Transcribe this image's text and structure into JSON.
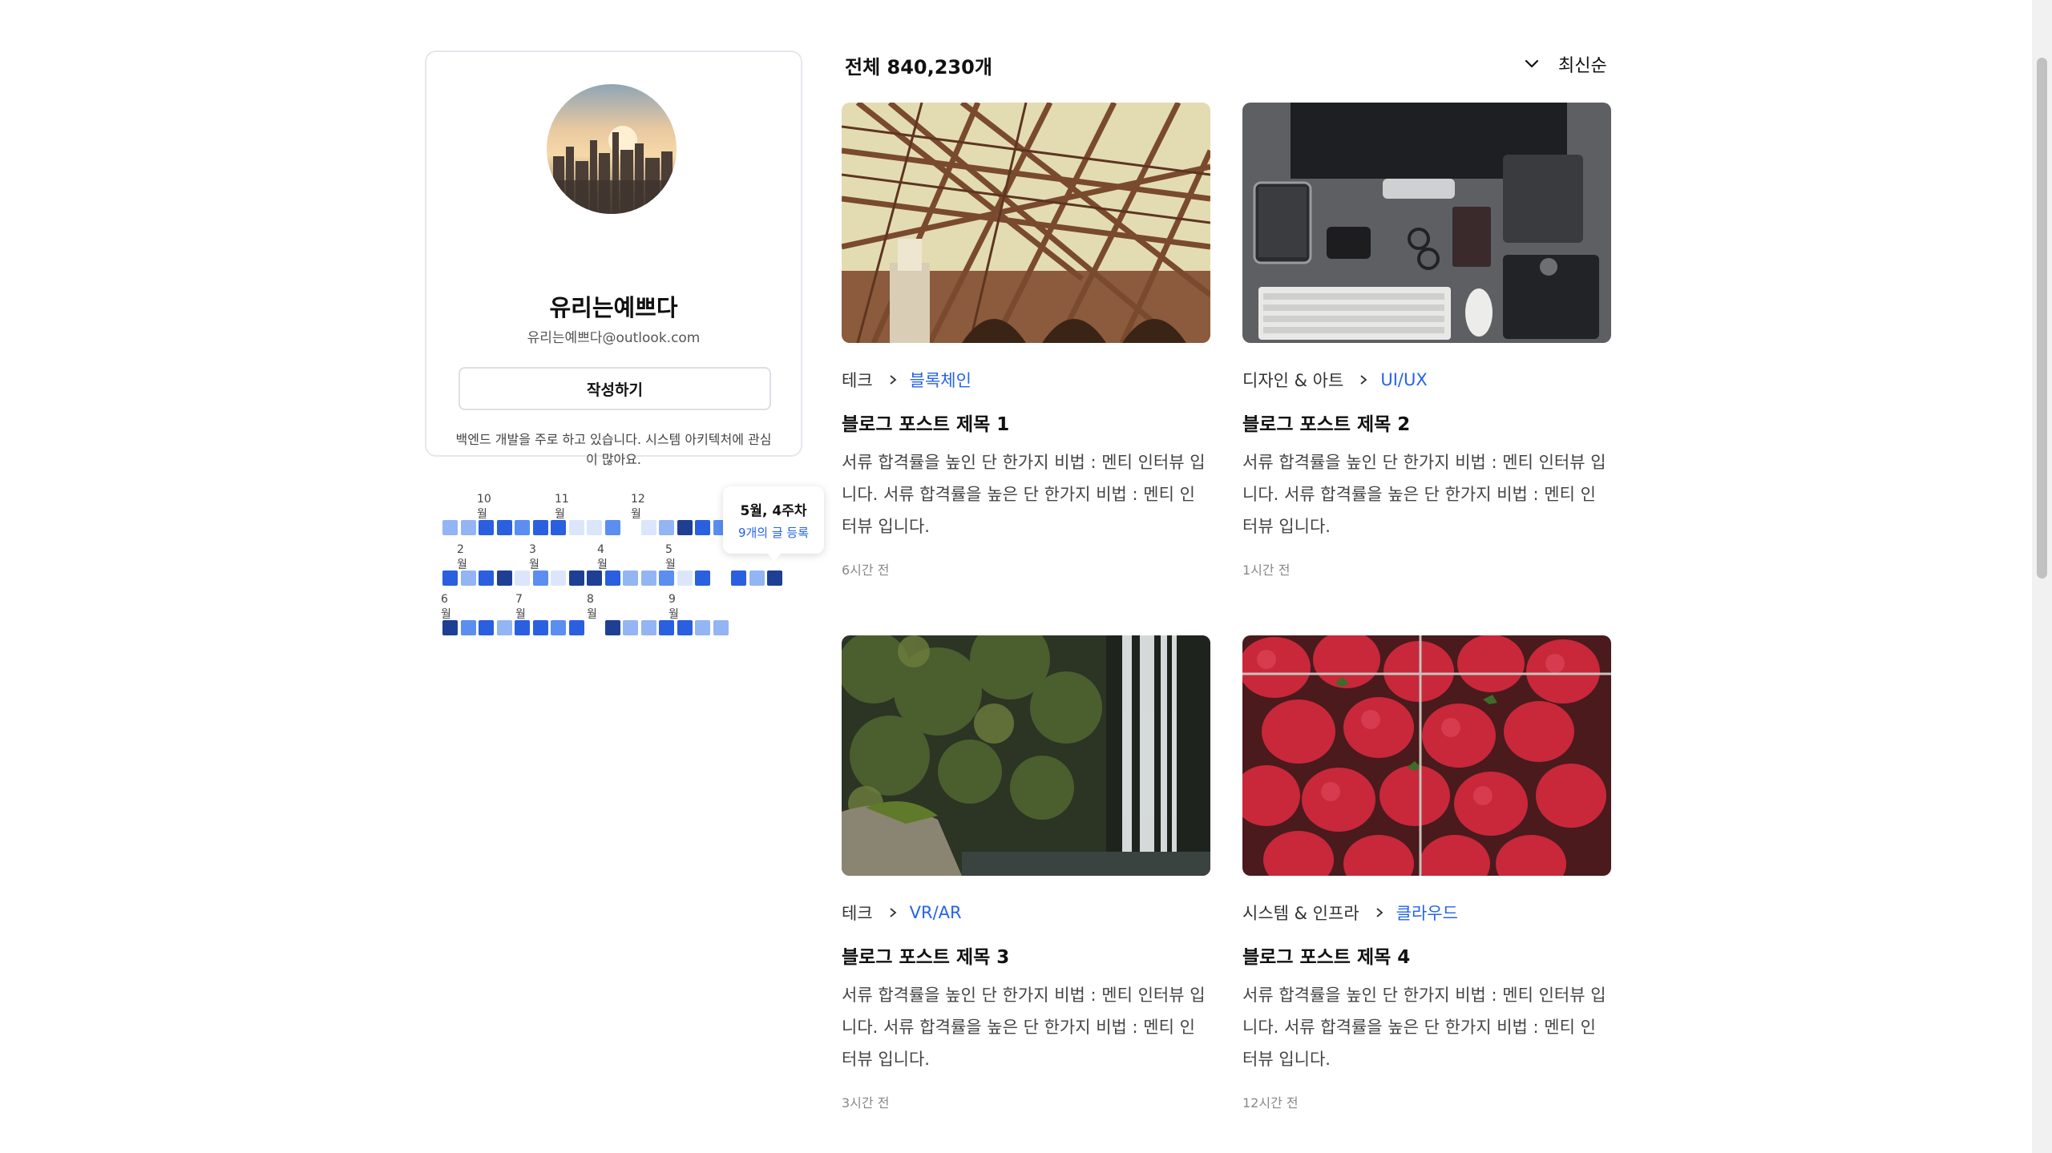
{
  "profile": {
    "name": "유리는예쁘다",
    "email": "유리는예쁘다@outlook.com",
    "write_label": "작성하기",
    "bio": "백엔드 개발을 주로 하고 있습니다. 시스템 아키텍처에 관심이 많아요."
  },
  "heatmap": {
    "rows": [
      {
        "months": [
          "10월",
          "11월",
          "12월"
        ],
        "levels": [
          2,
          2,
          4,
          4,
          3,
          4,
          4,
          1,
          1,
          3,
          0,
          1,
          2,
          5,
          4,
          3
        ]
      },
      {
        "months": [
          "2월",
          "3월",
          "4월",
          "5월"
        ],
        "levels": [
          4,
          2,
          4,
          5,
          1,
          3,
          1,
          5,
          5,
          4,
          2,
          2,
          3,
          1,
          4,
          0,
          4,
          2,
          5
        ]
      },
      {
        "months": [
          "6월",
          "7월",
          "8월",
          "9월"
        ],
        "levels": [
          5,
          3,
          4,
          2,
          4,
          4,
          3,
          4,
          0,
          5,
          2,
          2,
          4,
          4,
          2,
          2
        ]
      }
    ],
    "colors": [
      "#ffffff",
      "#dbe6fb",
      "#93b5f3",
      "#5b8ef0",
      "#2a5fe0",
      "#1e3f93"
    ],
    "tooltip": {
      "title": "5월, 4주차",
      "subtitle": "9개의 글 등록"
    }
  },
  "list": {
    "total_label": "전체 840,230개",
    "sort_label": "최신순"
  },
  "posts": [
    {
      "category": "테크",
      "subcategory": "블록체인",
      "title": "블로그 포스트 제목 1",
      "excerpt": "서류 합격률을 높인 단 한가지 비법 : 멘티 인터뷰 입니다. 서류 합격률을 높은 단 한가지 비법 : 멘티 인터뷰 입니다.",
      "time": "6시간 전",
      "image": "bridge"
    },
    {
      "category": "디자인 & 아트",
      "subcategory": "UI/UX",
      "title": "블로그 포스트 제목 2",
      "excerpt": "서류 합격률을 높인 단 한가지 비법 : 멘티 인터뷰 입니다. 서류 합격률을 높은 단 한가지 비법 : 멘티 인터뷰 입니다.",
      "time": "1시간 전",
      "image": "desk"
    },
    {
      "category": "테크",
      "subcategory": "VR/AR",
      "title": "블로그 포스트 제목 3",
      "excerpt": "서류 합격률을 높인 단 한가지 비법 : 멘티 인터뷰 입니다. 서류 합격률을 높은 단 한가지 비법 : 멘티 인터뷰 입니다.",
      "time": "3시간 전",
      "image": "waterfall"
    },
    {
      "category": "시스템 & 인프라",
      "subcategory": "클라우드",
      "title": "블로그 포스트 제목 4",
      "excerpt": "서류 합격률을 높인 단 한가지 비법 : 멘티 인터뷰 입니다. 서류 합격률을 높은 단 한가지 비법 : 멘티 인터뷰 입니다.",
      "time": "12시간 전",
      "image": "strawberries"
    }
  ]
}
